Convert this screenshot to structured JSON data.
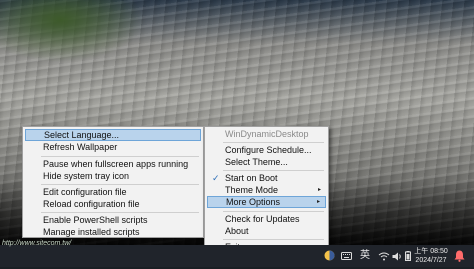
{
  "left_menu": {
    "items": [
      {
        "label": "Select Language..."
      },
      {
        "label": "Refresh Wallpaper"
      },
      {
        "label": "Pause when fullscreen apps running"
      },
      {
        "label": "Hide system tray icon"
      },
      {
        "label": "Edit configuration file"
      },
      {
        "label": "Reload configuration file"
      },
      {
        "label": "Enable PowerShell scripts"
      },
      {
        "label": "Manage installed scripts"
      }
    ],
    "highlighted": "Select Language..."
  },
  "right_menu": {
    "title": "WinDynamicDesktop",
    "items": [
      {
        "label": "Configure Schedule..."
      },
      {
        "label": "Select Theme..."
      },
      {
        "label": "Start on Boot",
        "checked": true
      },
      {
        "label": "Theme Mode",
        "submenu": true
      },
      {
        "label": "More Options",
        "submenu": true
      },
      {
        "label": "Check for Updates"
      },
      {
        "label": "About"
      },
      {
        "label": "Exit"
      }
    ],
    "highlighted": "More Options",
    "submenu_arrow": "▸",
    "check_mark": "✓"
  },
  "taskbar": {
    "watermark": "http://www.sitecom.tw/",
    "keyboard_icon": "keyboard-icon",
    "ime_label": "英",
    "wifi_icon": "wifi-icon",
    "volume_icon": "volume-icon",
    "battery_icon": "battery-icon",
    "time": "上午 08:50",
    "date": "2024/7/27",
    "notification_icon": "bell-icon"
  },
  "colors": {
    "menu_bg": "#f2f2f2",
    "highlight_bg": "#b9d3ec",
    "highlight_border": "#6ea5d8",
    "taskbar_bg": "#20242b"
  }
}
